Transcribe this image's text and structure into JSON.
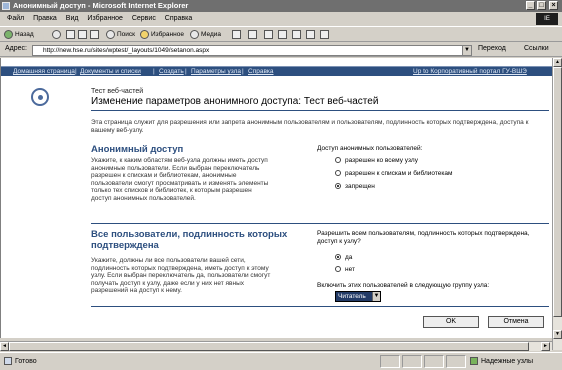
{
  "window": {
    "title": "Анонимный доступ - Microsoft Internet Explorer",
    "brand_label": "IE"
  },
  "menu": {
    "items": [
      "Файл",
      "Правка",
      "Вид",
      "Избранное",
      "Сервис",
      "Справка"
    ]
  },
  "toolbar": {
    "back_label": "Назад",
    "search_label": "Поиск",
    "favorites_label": "Избранное",
    "media_label": "Медиа"
  },
  "address": {
    "label": "Адрес:",
    "url": "http://new.hse.ru/sites/wptest/_layouts/1049/setanon.aspx",
    "go_label": "Переход",
    "links_label": "Ссылки"
  },
  "topnav": {
    "items": [
      "Домашняя страница",
      "Документы и списки",
      "Создать",
      "Параметры узла",
      "Справка"
    ],
    "right_link": "Up to Корпоративный портал ГУ-ВШЭ"
  },
  "header": {
    "breadcrumb": "Тест веб-частей",
    "title": "Изменение параметров анонимного доступа: Тест веб-частей",
    "description": "Эта страница служит для разрешения или запрета анонимным пользователям и пользователям, подлинность которых подтверждена, доступа к вашему веб-узлу."
  },
  "anon": {
    "title": "Анонимный доступ",
    "text": "Укажите, к каким областям веб-узла должны иметь доступ анонимные пользователи. Если выбран переключатель разрешен к спискам и библиотекам, анонимные пользователи смогут просматривать и изменять элементы только тех списков и библиотек, к которым разрешен доступ анонимных пользователей.",
    "right_label": "Доступ анонимных пользователей:",
    "options": [
      "разрешен ко всему узлу",
      "разрешен к спискам и библиотекам",
      "запрещен"
    ],
    "selected": "запрещен"
  },
  "auth": {
    "title": "Все пользователи, подлинность которых подтверждена",
    "text": "Укажите, должны ли все пользователи вашей сети, подлинность которых подтверждена, иметь доступ к этому узлу. Если выбран переключатель да, пользователи смогут получать доступ к узлу, даже если у них нет явных разрешений на доступ к нему.",
    "right_label": "Разрешить всем пользователям, подлинность которых подтверждена, доступ к узлу?",
    "options": [
      "да",
      "нет"
    ],
    "selected": "да",
    "group_label": "Включить этих пользователей в следующую группу узла:",
    "group_value": "Читатель"
  },
  "buttons": {
    "ok": "OK",
    "cancel": "Отмена"
  },
  "status": {
    "text": "Готово",
    "zone": "Надежные узлы"
  }
}
